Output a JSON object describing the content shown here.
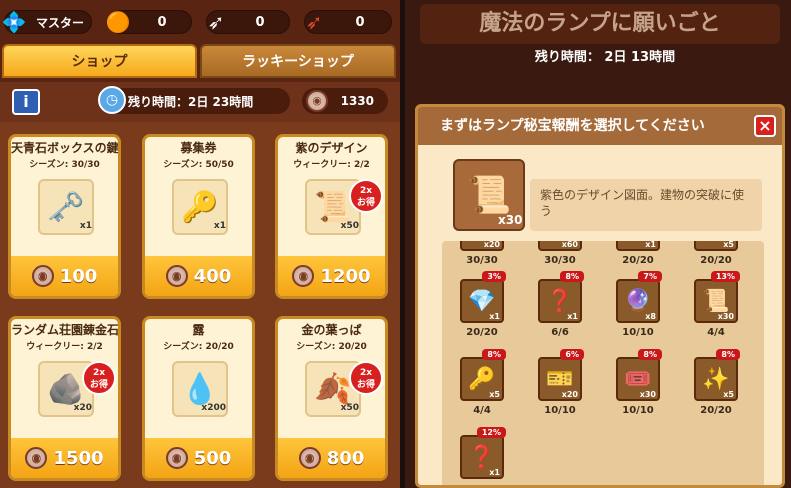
{
  "topbar": {
    "rank_label": "マスター",
    "currency": [
      {
        "icon": "orange-orb-icon",
        "value": "0"
      },
      {
        "icon": "grey-arrow-icon",
        "value": "0"
      },
      {
        "icon": "red-arrow-icon",
        "value": "0"
      }
    ]
  },
  "tabs": {
    "shop": "ショップ",
    "lucky_shop": "ラッキーショップ"
  },
  "info": {
    "timer": "残り時間：2日 23時間",
    "coins": "1330"
  },
  "cards": [
    {
      "title": "天青石ボックスの鍵",
      "sub": "シーズン: 30/30",
      "qty": "x1",
      "price": "100",
      "icon": "key-icon"
    },
    {
      "title": "募集券",
      "sub": "シーズン: 50/50",
      "qty": "x1",
      "price": "400",
      "icon": "golden-key-icon"
    },
    {
      "title": "紫のデザイン",
      "sub": "ウィークリー: 2/2",
      "qty": "x50",
      "price": "1200",
      "icon": "scroll-icon",
      "badge": "2x\nお得"
    },
    {
      "title": "ランダム荘園錬金石",
      "sub": "ウィークリー: 2/2",
      "qty": "x20",
      "price": "1500",
      "icon": "stone-icon",
      "badge": "2x\nお得"
    },
    {
      "title": "露",
      "sub": "シーズン: 20/20",
      "qty": "x200",
      "price": "500",
      "icon": "water-drop-icon"
    },
    {
      "title": "金の葉っぱ",
      "sub": "シーズン: 20/20",
      "qty": "x50",
      "price": "800",
      "icon": "leaf-icon",
      "badge": "2x\nお得"
    }
  ],
  "right": {
    "title": "魔法のランプに願いごと",
    "timer": "残り時間： 2日 13時間",
    "dialog_title": "まずはランプ秘宝報酬を選択してください",
    "close": "×",
    "selected_qty": "x30",
    "selected_desc": "紫色のデザイン図面。建物の突破に使う",
    "grid": [
      {
        "q": "x20",
        "c": "30/30",
        "p": ""
      },
      {
        "q": "x60",
        "c": "30/30",
        "p": ""
      },
      {
        "q": "x1",
        "c": "20/20",
        "p": ""
      },
      {
        "q": "x5",
        "c": "20/20",
        "p": ""
      },
      {
        "q": "x1",
        "c": "20/20",
        "p": "3%"
      },
      {
        "q": "x1",
        "c": "6/6",
        "p": "8%"
      },
      {
        "q": "x8",
        "c": "10/10",
        "p": "7%"
      },
      {
        "q": "x30",
        "c": "4/4",
        "p": "13%"
      },
      {
        "q": "x5",
        "c": "4/4",
        "p": "8%"
      },
      {
        "q": "x20",
        "c": "10/10",
        "p": "6%"
      },
      {
        "q": "x30",
        "c": "10/10",
        "p": "8%"
      },
      {
        "q": "x5",
        "c": "20/20",
        "p": "8%"
      },
      {
        "q": "x1",
        "c": "",
        "p": "12%"
      }
    ]
  }
}
